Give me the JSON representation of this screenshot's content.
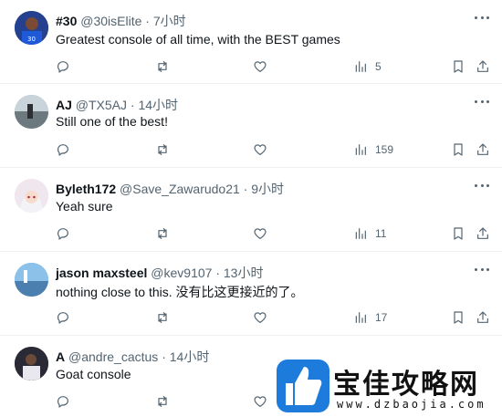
{
  "replies": [
    {
      "name": "#30",
      "handle": "@30isElite",
      "dot": "·",
      "time": "7小时",
      "text": "Greatest console of all time, with the BEST games",
      "views": "5",
      "avatar_color": "#1d4fa8"
    },
    {
      "name": "AJ",
      "handle": "@TX5AJ",
      "dot": "·",
      "time": "14小时",
      "text": "Still one of the best!",
      "views": "159",
      "avatar_color": "#8a9aa6"
    },
    {
      "name": "Byleth172",
      "handle": "@Save_Zawarudo21",
      "dot": "·",
      "time": "9小时",
      "text": "Yeah sure",
      "views": "11",
      "avatar_color": "#e9dde8"
    },
    {
      "name": "jason maxsteel",
      "handle": "@kev9107",
      "dot": "·",
      "time": "13小时",
      "text": "nothing close to this. 没有比这更接近的了。",
      "views": "17",
      "avatar_color": "#5aa0d8"
    },
    {
      "name": "A",
      "handle": "@andre_cactus",
      "dot": "·",
      "time": "14小时",
      "text": "Goat console",
      "views": "",
      "avatar_color": "#2c2c3a"
    }
  ],
  "icons": {
    "reply": "reply-icon",
    "retweet": "retweet-icon",
    "like": "heart-icon",
    "views": "views-icon",
    "bookmark": "bookmark-icon",
    "share": "share-icon",
    "more": "more-icon"
  },
  "watermark": {
    "title": "宝佳攻略网",
    "url": "www.dzbaojia.com",
    "logo_color": "#1d7bdc"
  },
  "colors": {
    "text_primary": "#0f1419",
    "text_secondary": "#536471",
    "divider": "#eff3f4"
  }
}
